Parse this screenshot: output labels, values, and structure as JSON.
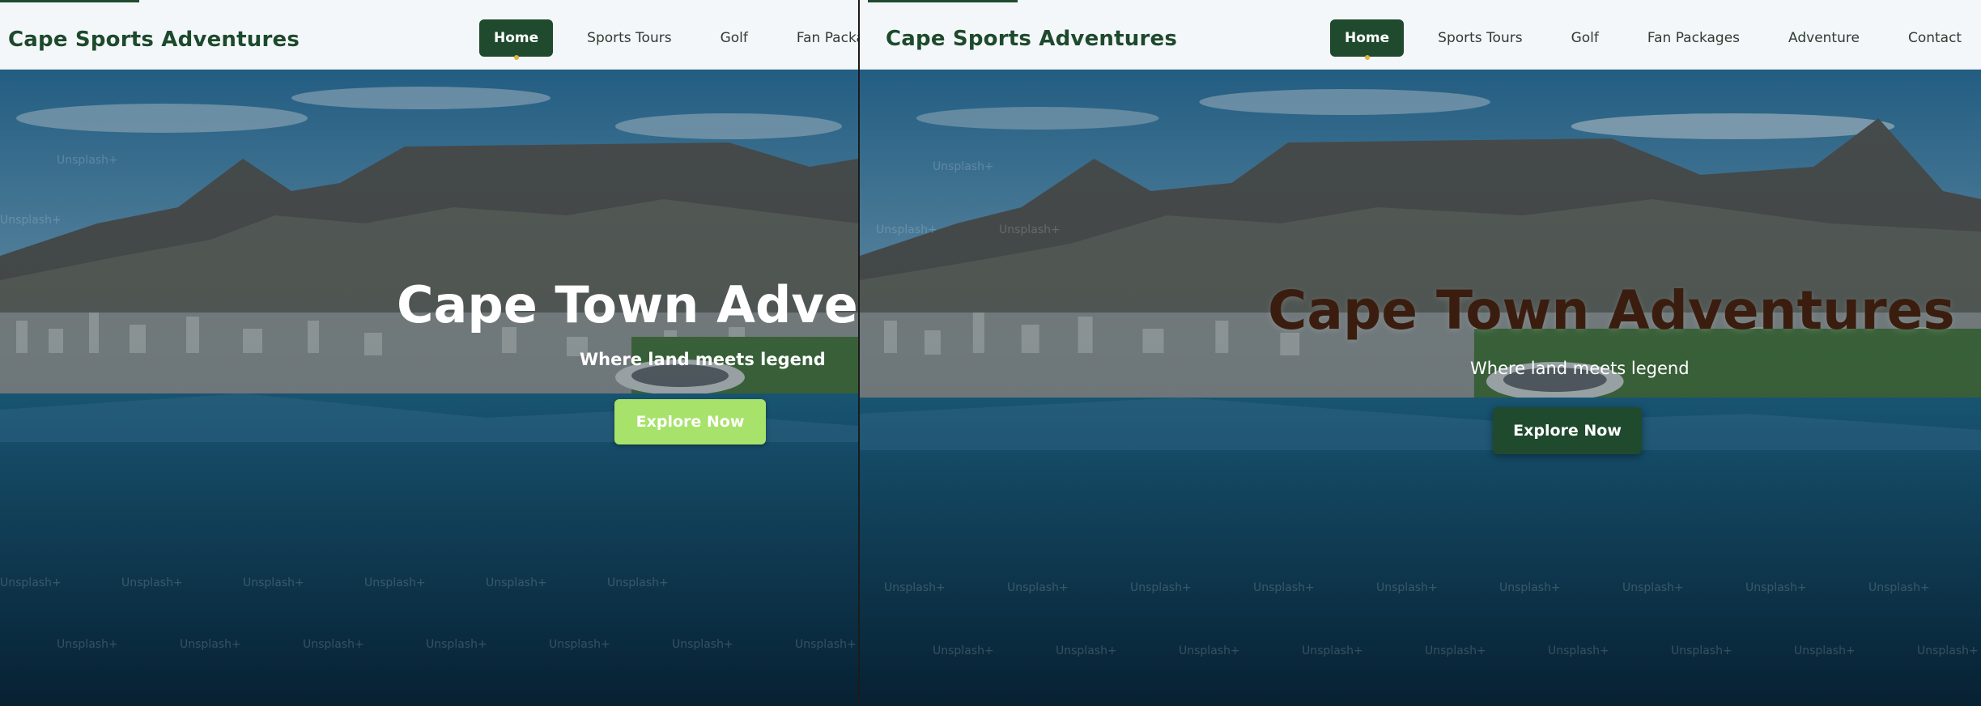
{
  "panes": [
    {
      "id": "left",
      "nav": {
        "logo": "Cape Sports Adventures",
        "items": [
          "Home",
          "Sports Tours",
          "Golf",
          "Fan Packag"
        ]
      },
      "hero": {
        "title": "Cape Town Advent",
        "subtitle": "Where land meets legend",
        "cta": "Explore Now"
      }
    },
    {
      "id": "right",
      "nav": {
        "logo": "Cape Sports Adventures",
        "items": [
          "Home",
          "Sports Tours",
          "Golf",
          "Fan Packages",
          "Adventure",
          "Contact"
        ]
      },
      "hero": {
        "title": "Cape Town Adventures",
        "subtitle": "Where land meets legend",
        "cta": "Explore Now"
      }
    }
  ],
  "watermark_text": "Unsplash+",
  "colors": {
    "brand_green": "#1f4a2e",
    "cta_light_green": "#a7e26a",
    "accent_gold": "#e0b43c",
    "title_brown": "#3b1d0f"
  }
}
